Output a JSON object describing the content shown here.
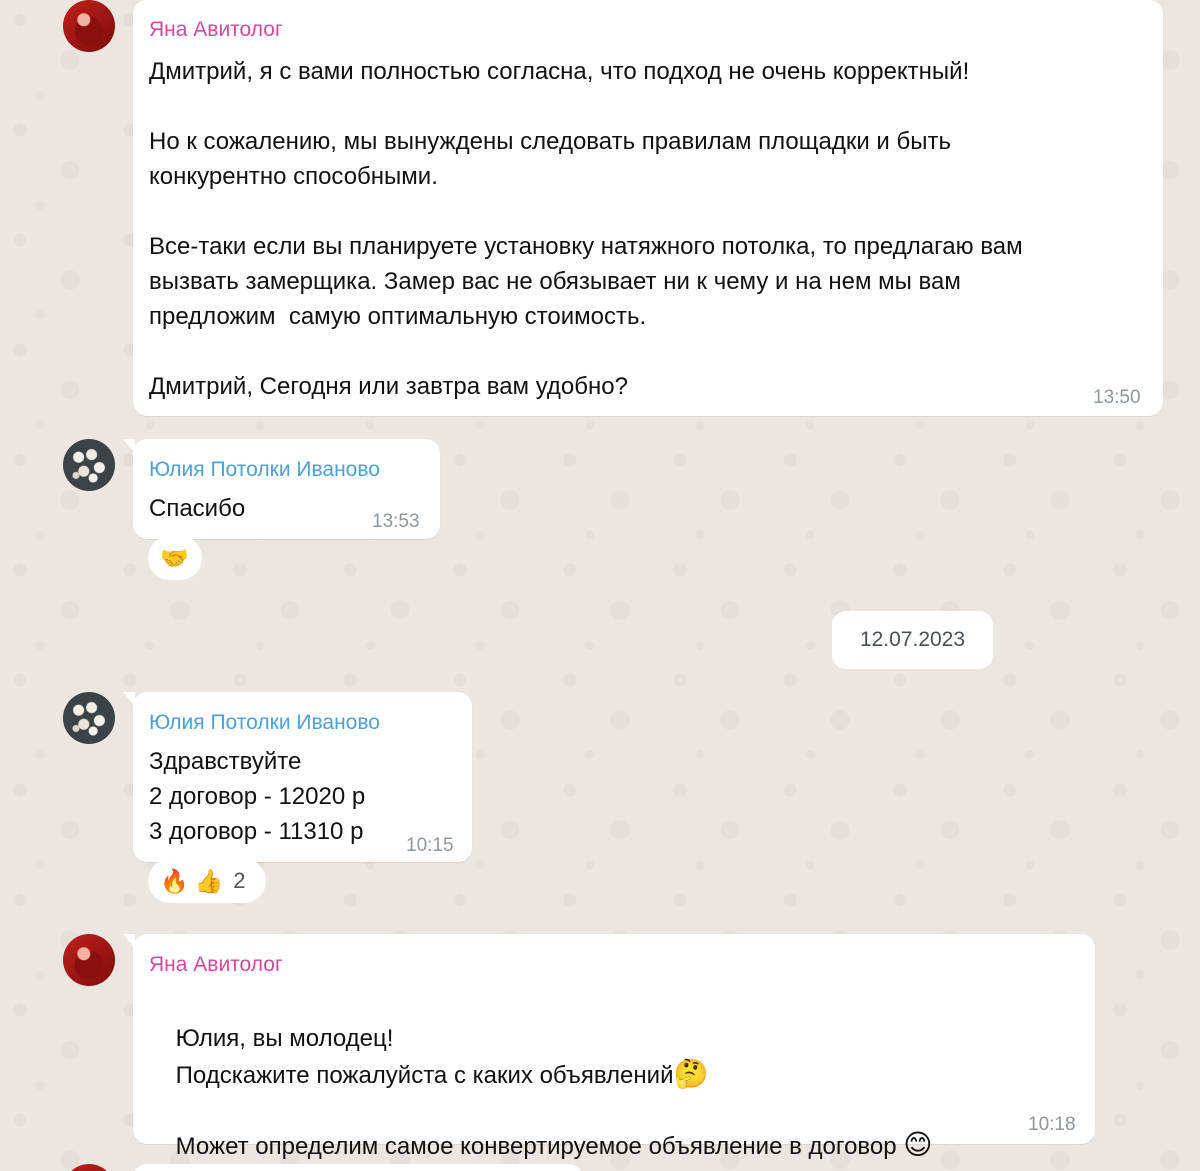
{
  "messages": [
    {
      "sender": "Яна Авитолог",
      "lines": "Дмитрий, я с вами полностью согласна, что подход не очень корректный!\n\nНо к сожалению, мы вынуждены следовать правилам площадки и быть\nконкурентно способными.\n\nВсе-таки если вы планируете установку натяжного потолка, то предлагаю вам\nвызвать замерщика. Замер вас не обязывает ни к чему и на нем мы вам\nпредложим  самую оптимальную стоимость.\n\nДмитрий, Сегодня или завтра вам удобно?",
      "time": "13:50"
    },
    {
      "sender": "Юлия Потолки Иваново",
      "lines": "Спасибо",
      "time": "13:53",
      "reactions": [
        "🤝"
      ]
    },
    {
      "sender": "Юлия Потолки Иваново",
      "lines": "Здравствуйте\n2 договор - 12020 р\n3 договор - 11310 р",
      "time": "10:15",
      "reactions": [
        "🔥",
        "👍"
      ],
      "reaction_count": "2"
    },
    {
      "sender": "Яна Авитолог",
      "line1": "Юлия, вы молодец!",
      "line2": "Подскажите пожалуйста с каких объявлений",
      "line2_emoji": "🤔",
      "line3": "Может определим самое конвертируемое объявление в договор",
      "line3_emoji": "😊",
      "time": "10:18"
    }
  ],
  "date_separator": "12.07.2023",
  "colors": {
    "sender_yana": "#d44a9a",
    "sender_yulia": "#4f9fd6",
    "time": "#8f969c",
    "background": "#ebe6df"
  }
}
